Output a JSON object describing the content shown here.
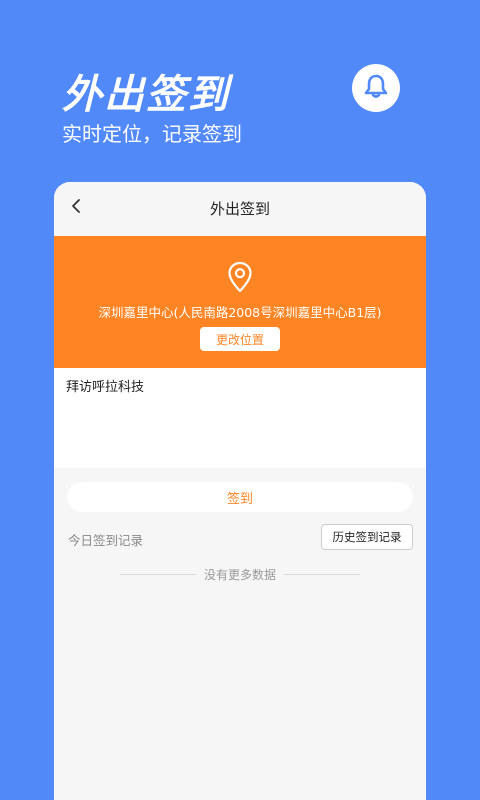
{
  "hero": {
    "title": "外出签到",
    "subtitle": "实时定位，记录签到"
  },
  "nav": {
    "title": "外出签到"
  },
  "location": {
    "address": "深圳嘉里中心(人民南路2008号深圳嘉里中心B1层)",
    "change_label": "更改位置"
  },
  "visit": {
    "text": "拜访呼拉科技"
  },
  "checkin": {
    "label": "签到"
  },
  "records": {
    "today_label": "今日签到记录",
    "history_label": "历史签到记录",
    "no_more": "没有更多数据"
  },
  "colors": {
    "background": "#5189f9",
    "accent": "#ff8524",
    "card": "#f6f6f6"
  },
  "icons": [
    "bell-icon",
    "back-chevron-icon",
    "location-pin-icon"
  ]
}
